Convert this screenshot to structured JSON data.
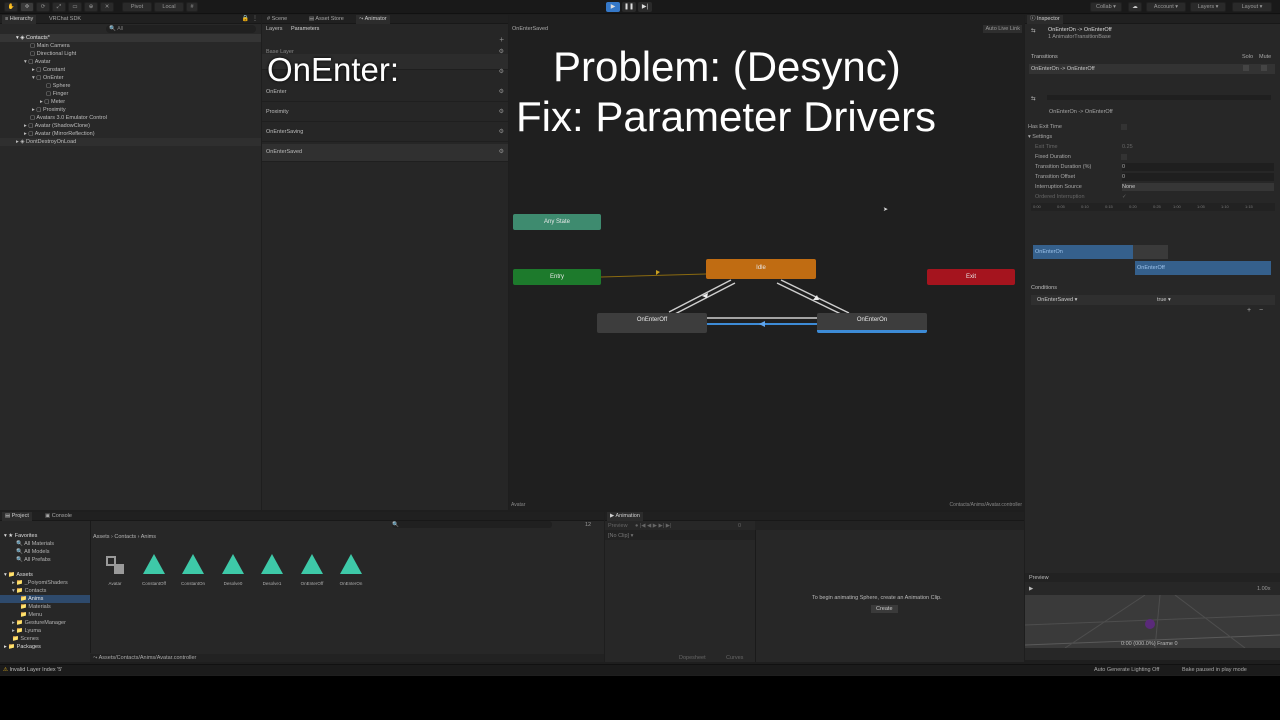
{
  "toolbar": {
    "pivot_label": "Pivot",
    "local_label": "Local",
    "collab_label": "Collab",
    "account_label": "Account",
    "layers_label": "Layers",
    "layout_label": "Layout"
  },
  "hierarchy": {
    "tabs": [
      "Hierarchy",
      "VRChat SDK"
    ],
    "search_placeholder": "All",
    "items": [
      {
        "label": "Contacts*"
      },
      {
        "label": "Main Camera"
      },
      {
        "label": "Directional Light"
      },
      {
        "label": "Avatar"
      },
      {
        "label": "Constant"
      },
      {
        "label": "OnEnter"
      },
      {
        "label": "Sphere"
      },
      {
        "label": "Finger"
      },
      {
        "label": "Meter"
      },
      {
        "label": "Proximity"
      },
      {
        "label": "Avatars 3.0 Emulator Control"
      },
      {
        "label": "Avatar (ShadowClone)"
      },
      {
        "label": "Avatar (MirrorReflection)"
      },
      {
        "label": "DontDestroyOnLoad"
      }
    ]
  },
  "animator": {
    "tabs": [
      "Scene",
      "Asset Store",
      "Animator"
    ],
    "subtabs": [
      "Layers",
      "Parameters"
    ],
    "base_layer": "Base Layer",
    "breadcrumb": "OnEnterSaved",
    "auto_live_link": "Auto Live Link",
    "params": [
      {
        "name": "OnEnter"
      },
      {
        "name": "Proximity"
      },
      {
        "name": "OnEnterSaving"
      },
      {
        "name": "OnEnterSaved"
      }
    ],
    "states": {
      "any": "Any State",
      "entry": "Entry",
      "idle": "Idle",
      "exit": "Exit",
      "off": "OnEnterOff",
      "on": "OnEnterOn"
    },
    "footer_left": "Avatar",
    "footer_right": "Contacts/Anims/Avatar.controller"
  },
  "overlay": {
    "onenter": "OnEnter:",
    "line1": "Problem: (Desync)",
    "line2": "Fix: Parameter Drivers"
  },
  "inspector": {
    "tab": "Inspector",
    "title": "OnEnterOn -> OnEnterOff",
    "subtitle": "1 AnimatorTransitionBase",
    "transitions_label": "Transitions",
    "solo": "Solo",
    "mute": "Mute",
    "transition_item": "OnEnterOn -> OnEnterOff",
    "sub_title": "OnEnterOn -> OnEnterOff",
    "has_exit_time": "Has Exit Time",
    "settings": "Settings",
    "exit_time": "Exit Time",
    "exit_time_val": "0.25",
    "fixed_duration": "Fixed Duration",
    "transition_duration": "Transition Duration (%)",
    "transition_duration_val": "0",
    "transition_offset": "Transition Offset",
    "transition_offset_val": "0",
    "interruption_source": "Interruption Source",
    "interruption_source_val": "None",
    "ordered_interruption": "Ordered Interruption",
    "timeline_ticks": [
      "0:00",
      "0:05",
      "0:10",
      "0:15",
      "0:20",
      "0:25",
      "1:00",
      "1:05",
      "1:10",
      "1:15"
    ],
    "timeline_a": "OnEnterOn",
    "timeline_b": "OnEnterOff",
    "conditions": "Conditions",
    "cond_param": "OnEnterSaved",
    "cond_value": "true",
    "preview": "Preview",
    "preview_speed": "1.00x",
    "preview_time": "0:00 (000.0%) Frame 0"
  },
  "project": {
    "tabs": [
      "Project",
      "Console"
    ],
    "count": "12",
    "favorites": "Favorites",
    "fav_items": [
      "All Materials",
      "All Models",
      "All Prefabs"
    ],
    "assets_label": "Assets",
    "tree": [
      "_PoiyomiShaders",
      "Contacts",
      "Anims",
      "Materials",
      "Menu",
      "GestureManager",
      "Lyuma",
      "Scenes"
    ],
    "packages": "Packages",
    "breadcrumb": [
      "Assets",
      "Contacts",
      "Anims"
    ],
    "assets": [
      {
        "name": "Avatar"
      },
      {
        "name": "ConstantOff"
      },
      {
        "name": "ConstantOn"
      },
      {
        "name": "Desolve0"
      },
      {
        "name": "Desolve1"
      },
      {
        "name": "OnEnterOff"
      },
      {
        "name": "OnEnterOn"
      }
    ],
    "path": "Assets/Contacts/Anims/Avatar.controller"
  },
  "animation": {
    "tab": "Animation",
    "preview": "Preview",
    "clip": "[No Clip]",
    "frame": "0",
    "message": "To begin animating Sphere, create an Animation Clip.",
    "create": "Create",
    "dopesheet": "Dopesheet",
    "curves": "Curves"
  },
  "status": {
    "warning": "Invalid Layer Index '5'",
    "lighting": "Auto Generate Lighting Off",
    "bake": "Bake paused in play mode"
  },
  "colors": {
    "any_state": "#3e8b6f",
    "entry": "#1d7a2c",
    "idle": "#c06c12",
    "exit": "#a5141e",
    "state_gray": "#3d3d3d",
    "selected": "#3d8bd6",
    "play_blue": "#3578c8"
  }
}
